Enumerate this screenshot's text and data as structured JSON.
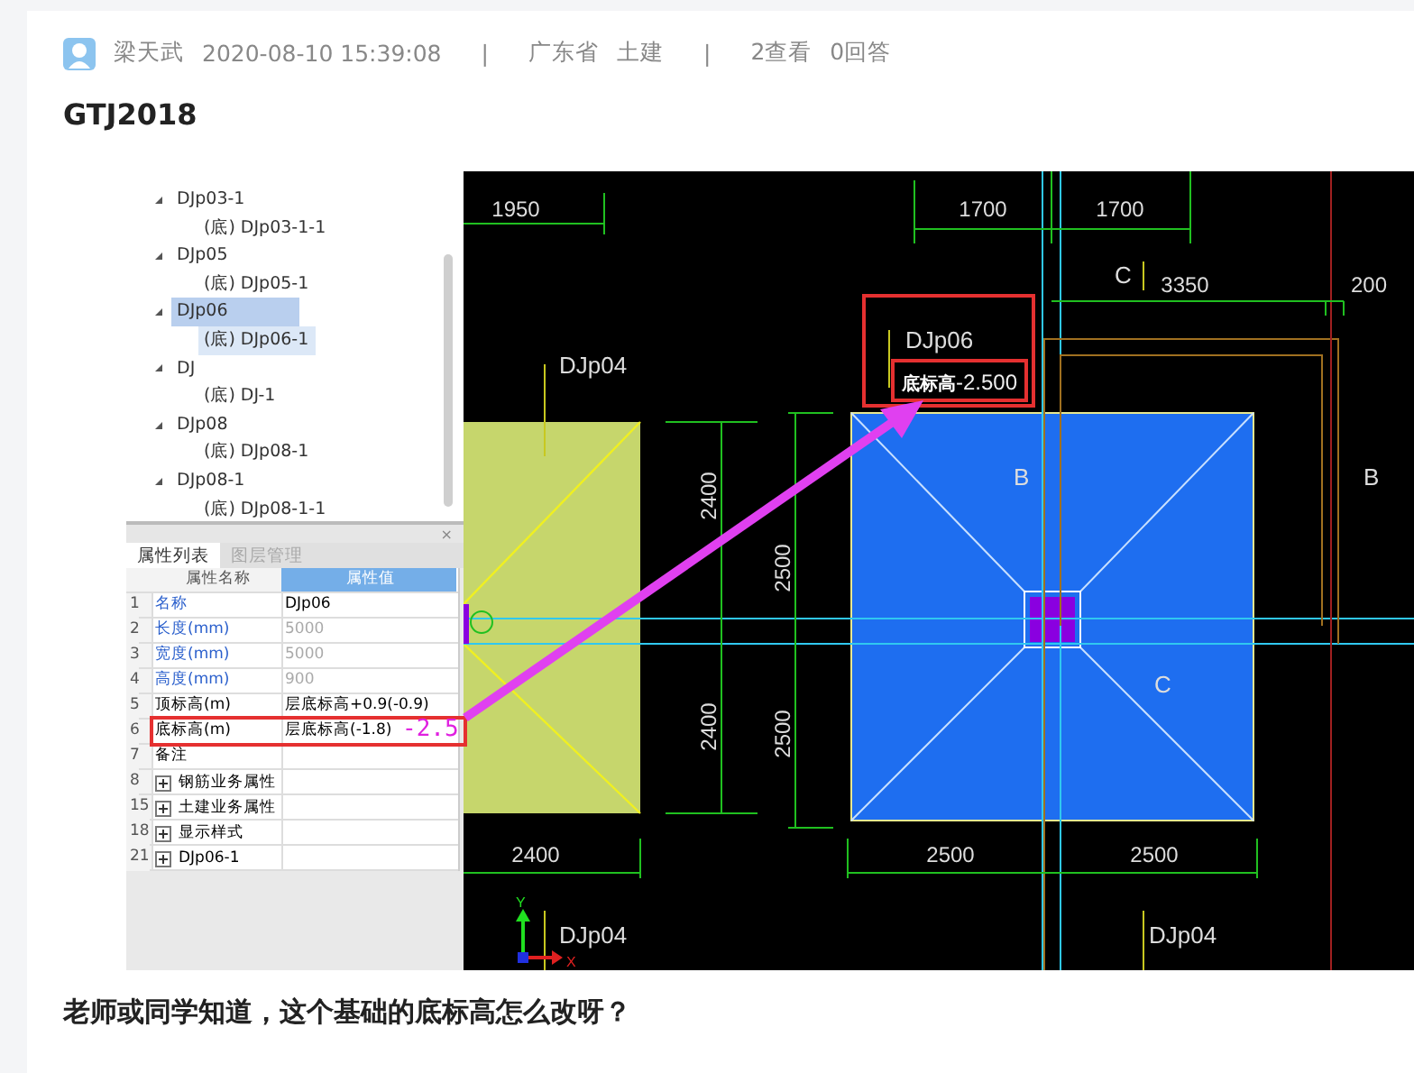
{
  "post": {
    "author": "梁天武",
    "time": "2020-08-10 15:39:08",
    "separator_1": "|",
    "province": "广东省",
    "category": "土建",
    "separator_2": "|",
    "views": "2查看",
    "answers": "0回答"
  },
  "title": "GTJ2018",
  "screenshot": {
    "tree": [
      {
        "label": "DJp03-1",
        "expanded": true,
        "selected": false,
        "children": [
          {
            "label": "(底) DJp03-1-1",
            "selected": false
          }
        ]
      },
      {
        "label": "DJp05",
        "expanded": true,
        "selected": false,
        "children": [
          {
            "label": "(底) DJp05-1",
            "selected": false
          }
        ]
      },
      {
        "label": "DJp06",
        "expanded": true,
        "selected": true,
        "children": [
          {
            "label": "(底) DJp06-1",
            "selected": true
          }
        ]
      },
      {
        "label": "DJ",
        "expanded": true,
        "selected": false,
        "children": [
          {
            "label": "(底) DJ-1",
            "selected": false
          }
        ]
      },
      {
        "label": "DJp08",
        "expanded": true,
        "selected": false,
        "children": [
          {
            "label": "(底) DJp08-1",
            "selected": false
          }
        ]
      },
      {
        "label": "DJp08-1",
        "expanded": true,
        "selected": false,
        "children": [
          {
            "label": "(底) DJp08-1-1",
            "selected": false
          }
        ]
      }
    ],
    "panel": {
      "close": "×",
      "tabs": [
        {
          "label": "属性列表",
          "selected": true
        },
        {
          "label": "图层管理",
          "selected": false
        }
      ],
      "columns": [
        "属性名称",
        "属性值"
      ],
      "rows": [
        {
          "index": "1",
          "name": "名称",
          "value": "DJp06",
          "kind": "public",
          "disabled": false
        },
        {
          "index": "2",
          "name": "长度(mm)",
          "value": "5000",
          "kind": "public",
          "disabled": true
        },
        {
          "index": "3",
          "name": "宽度(mm)",
          "value": "5000",
          "kind": "public",
          "disabled": true
        },
        {
          "index": "4",
          "name": "高度(mm)",
          "value": "900",
          "kind": "public",
          "disabled": true
        },
        {
          "index": "5",
          "name": "顶标高(m)",
          "value": "层底标高+0.9(-0.9)",
          "kind": "private",
          "disabled": false
        },
        {
          "index": "6",
          "name": "底标高(m)",
          "value": "层底标高(-1.8)",
          "kind": "private",
          "disabled": false
        },
        {
          "index": "7",
          "name": "备注",
          "kind": "private"
        },
        {
          "index": "8",
          "name": "钢筋业务属性",
          "kind": "group",
          "expanded": false
        },
        {
          "index": "15",
          "name": "土建业务属性",
          "kind": "group",
          "expanded": false
        },
        {
          "index": "18",
          "name": "显示样式",
          "kind": "group",
          "expanded": false
        },
        {
          "index": "21",
          "name": "DJp06-1",
          "kind": "group",
          "expanded": false
        }
      ]
    },
    "cad": {
      "labels": [
        {
          "text": "1950",
          "kind": "dim"
        },
        {
          "text": "1700",
          "kind": "dim"
        },
        {
          "text": "1700",
          "kind": "dim"
        },
        {
          "text": "C",
          "kind": "tag"
        },
        {
          "text": "3350",
          "kind": "dim"
        },
        {
          "text": "200",
          "kind": "dim"
        },
        {
          "text": "DJp04",
          "kind": "tag"
        },
        {
          "text": "DJp06",
          "kind": "tag"
        },
        {
          "text": "B",
          "kind": "tag"
        },
        {
          "text": "B",
          "kind": "tag"
        },
        {
          "text": "2400",
          "kind": "vdim"
        },
        {
          "text": "2500",
          "kind": "vdim"
        },
        {
          "text": "2400",
          "kind": "vdim"
        },
        {
          "text": "2500",
          "kind": "vdim"
        },
        {
          "text": "C",
          "kind": "tag"
        },
        {
          "text": "2400",
          "kind": "dim"
        },
        {
          "text": "2500",
          "kind": "dim"
        },
        {
          "text": "2500",
          "kind": "dim"
        },
        {
          "text": "DJp04",
          "kind": "tag"
        },
        {
          "text": "DJp04",
          "kind": "tag"
        }
      ],
      "elevation_tag": {
        "prefix": "底标高",
        "value": "-2.500"
      },
      "axis": {
        "x": "X",
        "y": "Y"
      }
    },
    "annotation": {
      "text": "-2.5"
    }
  },
  "question": "老师或同学知道，这个基础的底标高怎么改呀？"
}
